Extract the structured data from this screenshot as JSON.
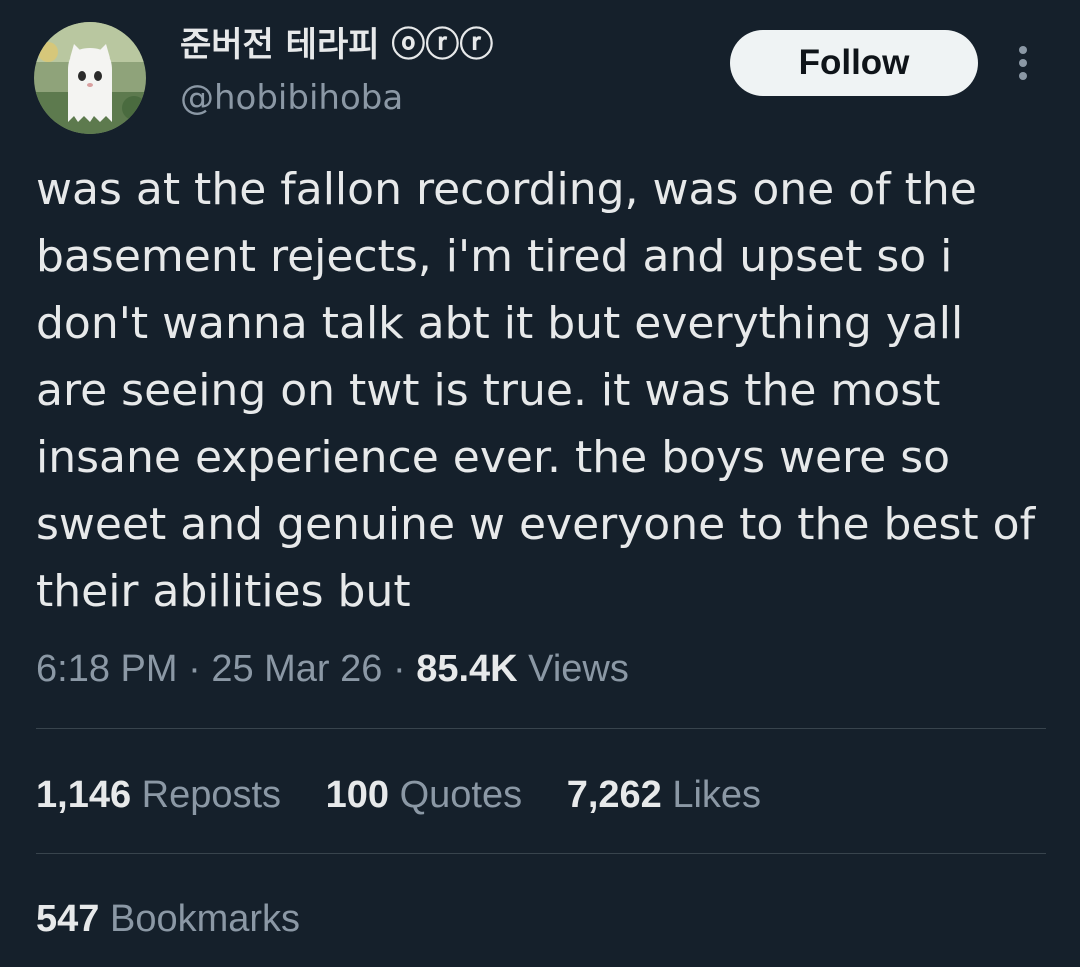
{
  "author": {
    "display_name": "준버전 테라피 ⓞⓡⓡ",
    "handle": "@hobibihoba",
    "avatar_icon": "ghost-plush-avatar"
  },
  "actions": {
    "follow_label": "Follow",
    "more_icon": "more-vertical-icon"
  },
  "tweet": {
    "text": "was at the fallon recording, was one of the basement rejects, i'm tired and upset so i don't wanna talk abt it but everything yall are seeing on twt is true. it was the most insane experience ever. the boys were so sweet and genuine w everyone to the best of their abilities but",
    "time": "6:18 PM",
    "date": "25 Mar 26",
    "separator": "·",
    "views_count": "85.4K",
    "views_label": "Views"
  },
  "stats": {
    "reposts_count": "1,146",
    "reposts_label": "Reposts",
    "quotes_count": "100",
    "quotes_label": "Quotes",
    "likes_count": "7,262",
    "likes_label": "Likes",
    "bookmarks_count": "547",
    "bookmarks_label": "Bookmarks"
  },
  "colors": {
    "background": "#15202b",
    "text_primary": "#e7e9ea",
    "text_secondary": "#8b98a5",
    "divider": "#38444d",
    "follow_button_bg": "#eff3f4"
  }
}
